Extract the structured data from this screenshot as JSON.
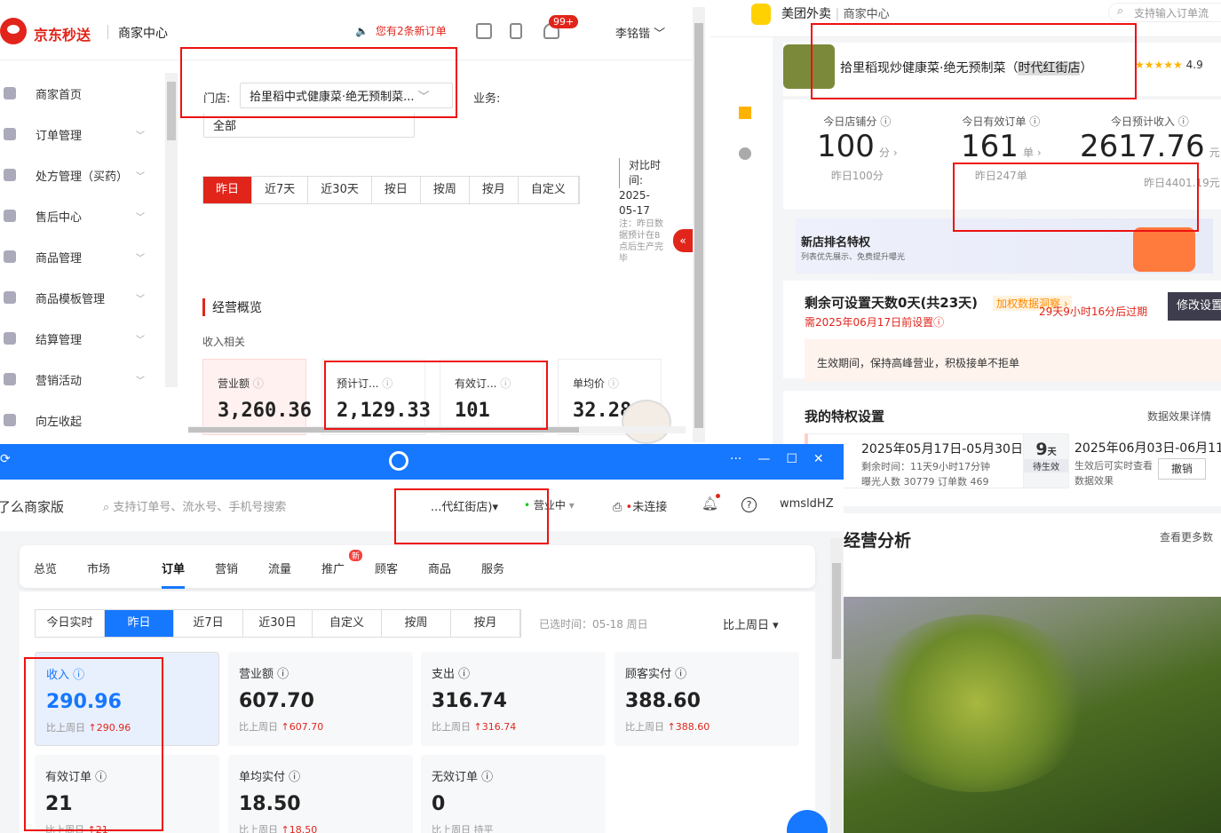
{
  "jd": {
    "brand": "京东秒送",
    "center": "商家中心",
    "new_orders": "您有2条新订单",
    "notify_count": "99+",
    "user": "李铭锴",
    "sidebar": [
      {
        "label": "商家首页",
        "chev": ""
      },
      {
        "label": "订单管理",
        "chev": "﹀"
      },
      {
        "label": "处方管理（买药）",
        "chev": "﹀"
      },
      {
        "label": "售后中心",
        "chev": "﹀"
      },
      {
        "label": "商品管理",
        "chev": "﹀"
      },
      {
        "label": "商品模板管理",
        "chev": "﹀"
      },
      {
        "label": "结算管理",
        "chev": "﹀"
      },
      {
        "label": "营销活动",
        "chev": "﹀"
      },
      {
        "label": "向左收起",
        "chev": ""
      }
    ],
    "store_label": "门店:",
    "store_value": "拾里稻中式健康菜·绝无预制菜...",
    "business_label": "业务:",
    "business_value": "全部",
    "tabs": [
      "昨日",
      "近7天",
      "近30天",
      "按日",
      "按周",
      "按月",
      "自定义"
    ],
    "compare_label": "对比时间:",
    "compare_date": "2025-05-17",
    "compare_note": "注：昨日数据预计在8点后生产完毕",
    "section": "经营概览",
    "subsection": "收入相关",
    "metrics": [
      {
        "label": "营业额",
        "value": "3,260.36"
      },
      {
        "label": "预计订...",
        "value": "2,129.33"
      },
      {
        "label": "有效订...",
        "value": "101"
      },
      {
        "label": "单均价",
        "value": "32.28"
      }
    ],
    "collapse": "«"
  },
  "mt": {
    "brand": "美团外卖",
    "center": "商家中心",
    "search_placeholder": "支持输入订单流",
    "shop_name": "拾里稻现炒健康菜·绝无预制菜（",
    "shop_branch": "时代红街店",
    "shop_close": "）",
    "stars": "★★★★★",
    "rating": "4.9",
    "kpis": [
      {
        "label": "今日店铺分 ⓘ",
        "value": "100",
        "unit": "分 ›",
        "prev": "昨日100分"
      },
      {
        "label": "今日有效订单 ⓘ",
        "value": "161",
        "unit": "单 ›",
        "prev": "昨日247单"
      },
      {
        "label": "今日预计收入 ⓘ",
        "value": "2617.76",
        "unit": "元",
        "prev": "昨日4401.19元"
      }
    ],
    "rank_title": "新店排名特权",
    "rank_sub": "列表优先展示、免费提升曝光",
    "remain": "剩余可设置天数0天(共23天)",
    "add_link": "加权数据洞察 ›",
    "set_by": "需2025年06月17日前设置ⓘ",
    "expire": "29天9小时16分后过期",
    "modify_btn": "修改设置",
    "tip": "生效期间，保持高峰营业，积极接单不拒单",
    "priv_title": "我的特权设置",
    "priv_right": "数据效果详情",
    "period1_range": "2025年05月17日-05月30日",
    "period1_remain": "剩余时间：11天9小时17分钟",
    "period1_stats": "曝光人数 30779 订单数 469",
    "days_num": "9",
    "days_unit": "天",
    "days_status": "待生效",
    "period2_range": "2025年06月03日-06月11",
    "period2_note1": "生效后可实时查看",
    "period2_note2": "数据效果",
    "cancel_btn": "撤销",
    "biz_title": "经营分析",
    "biz_more": "查看更多数"
  },
  "ele": {
    "brand": "饿了么商家版",
    "search_placeholder": "支持订单号、流水号、手机号搜索",
    "store": "...代红街店)▾",
    "status": "营业中",
    "printer": "未连接",
    "user": "wmsldHZ",
    "nav": [
      "总览",
      "市场",
      "订单",
      "营销",
      "流量",
      "推广",
      "顾客",
      "商品",
      "服务"
    ],
    "nav_badge": "新",
    "tabs": [
      "今日实时",
      "昨日",
      "近7日",
      "近30日",
      "自定义",
      "按周",
      "按月"
    ],
    "period": "已选时间：05-18 周日",
    "compare": "比上周日 ▾",
    "metrics": [
      {
        "label": "收入 ⓘ",
        "value": "290.96",
        "cmp_label": "比上周日",
        "cmp": "↑290.96"
      },
      {
        "label": "营业额 ⓘ",
        "value": "607.70",
        "cmp_label": "比上周日",
        "cmp": "↑607.70"
      },
      {
        "label": "支出 ⓘ",
        "value": "316.74",
        "cmp_label": "比上周日",
        "cmp": "↑316.74"
      },
      {
        "label": "顾客实付 ⓘ",
        "value": "388.60",
        "cmp_label": "比上周日",
        "cmp": "↑388.60"
      },
      {
        "label": "有效订单 ⓘ",
        "value": "21",
        "cmp_label": "比上周日",
        "cmp": "↑21"
      },
      {
        "label": "单均实付 ⓘ",
        "value": "18.50",
        "cmp_label": "比上周日",
        "cmp": "↑18.50"
      },
      {
        "label": "无效订单 ⓘ",
        "value": "0",
        "cmp_label": "比上周日 持平",
        "cmp": ""
      }
    ],
    "window_ctrls": [
      "···",
      "—",
      "☐",
      "✕"
    ]
  },
  "colors": {
    "jd_red": "#e1251b",
    "ele_blue": "#1677ff",
    "mt_yellow": "#ffd100",
    "annotation": "#ee1111"
  }
}
